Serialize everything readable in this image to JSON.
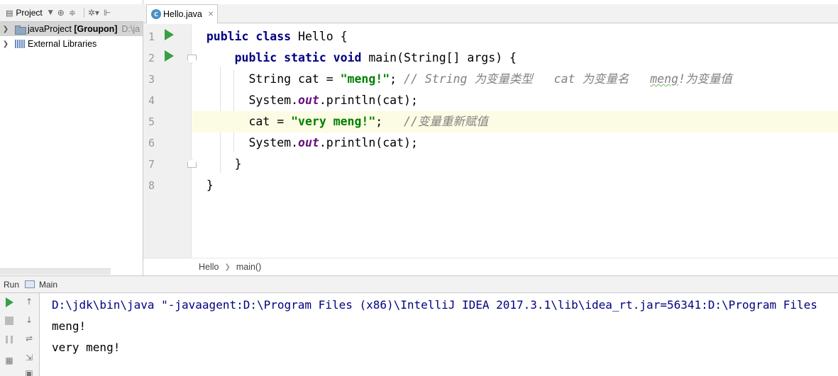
{
  "project_pane": {
    "toolbar_label": "Project",
    "tree": [
      {
        "name": "javaProject",
        "module": "[Groupon]",
        "path": "D:\\ja",
        "icon": "folder-icon"
      },
      {
        "name": "External Libraries",
        "icon": "library-icon"
      }
    ]
  },
  "editor": {
    "tab": {
      "label": "Hello.java",
      "icon_letter": "C"
    },
    "line_numbers": [
      "1",
      "2",
      "3",
      "4",
      "5",
      "6",
      "7",
      "8"
    ],
    "breadcrumb": [
      "Hello",
      "main()"
    ]
  },
  "run_panel": {
    "label": "Run",
    "config_name": "Main",
    "console_lines": [
      "D:\\jdk\\bin\\java \"-javaagent:D:\\Program Files (x86)\\IntelliJ IDEA 2017.3.1\\lib\\idea_rt.jar=56341:D:\\Program Files",
      "meng!",
      "very meng!"
    ]
  },
  "colors": {
    "keyword": "#000080",
    "string": "#008000",
    "comment": "#808080",
    "field": "#660e7a",
    "run_green": "#389f45",
    "current_line": "#fcfbe4"
  }
}
